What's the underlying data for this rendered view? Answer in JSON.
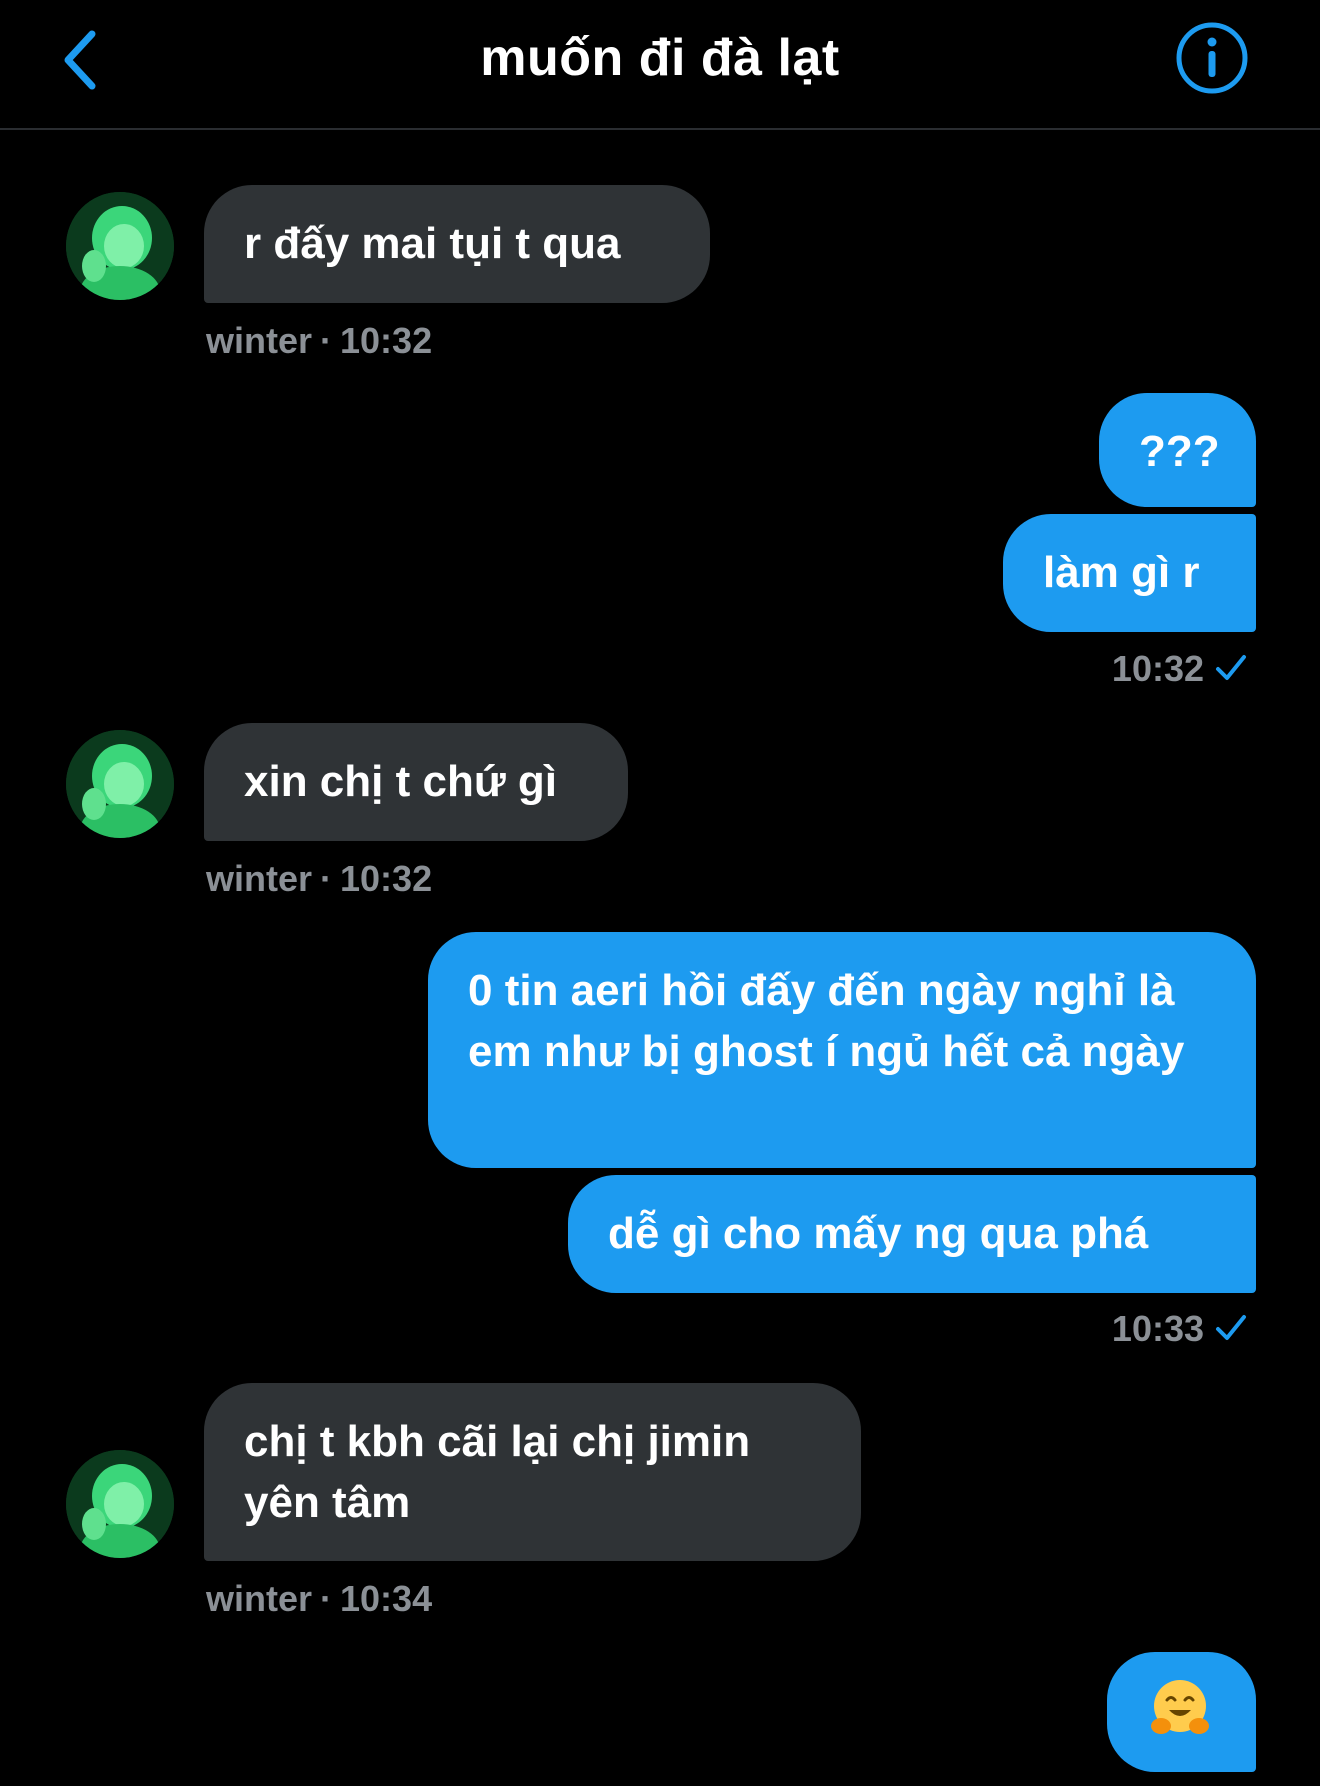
{
  "header": {
    "title": "muốn đi đà lạt",
    "back_icon": "chevron-left-icon",
    "info_icon": "info-icon"
  },
  "colors": {
    "background": "#000000",
    "incoming_bubble": "#2f3336",
    "outgoing_bubble": "#1d9bf0",
    "accent": "#1d9bf0",
    "meta_text": "#8b9096"
  },
  "messages": [
    {
      "direction": "incoming",
      "text": "r đấy mai tụi t qua",
      "sender": "winter",
      "time": "10:32"
    },
    {
      "direction": "outgoing",
      "text": "???"
    },
    {
      "direction": "outgoing",
      "text": "làm gì r",
      "time": "10:32",
      "status": "sent"
    },
    {
      "direction": "incoming",
      "text": "xin chị t chứ gì",
      "sender": "winter",
      "time": "10:32"
    },
    {
      "direction": "outgoing",
      "text": "0 tin aeri hồi đấy đến ngày nghỉ là em như bị ghost í ngủ hết cả ngày"
    },
    {
      "direction": "outgoing",
      "text": "dễ gì cho mấy ng qua phá",
      "time": "10:33",
      "status": "sent"
    },
    {
      "direction": "incoming",
      "text": "chị t kbh cãi lại chị jimin yên tâm",
      "sender": "winter",
      "time": "10:34"
    },
    {
      "direction": "outgoing",
      "emoji": "hugging-face-emoji"
    }
  ],
  "meta": {
    "separator": "·"
  }
}
